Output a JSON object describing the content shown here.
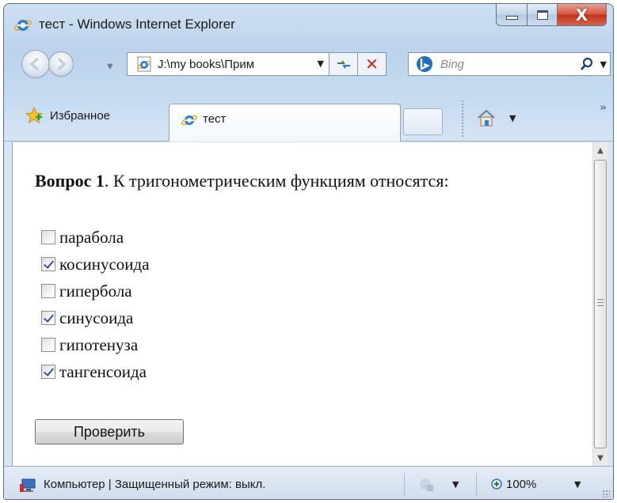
{
  "window": {
    "title": "тест - Windows Internet Explorer",
    "close_glyph": "X"
  },
  "nav": {
    "address": "J:\\my books\\Прим",
    "search_placeholder": "Bing"
  },
  "favorites": {
    "label": "Избранное"
  },
  "tab": {
    "label": "тест"
  },
  "content": {
    "question_bold": "Вопрос 1",
    "question_rest": ". К тригонометрическим функциям относятся:",
    "options": [
      {
        "label": "парабола",
        "checked": false
      },
      {
        "label": "косинусоида",
        "checked": true
      },
      {
        "label": "гипербола",
        "checked": false
      },
      {
        "label": "синусоида",
        "checked": true
      },
      {
        "label": "гипотенуза",
        "checked": false
      },
      {
        "label": "тангенсоида",
        "checked": true
      }
    ],
    "check_button": "Проверить"
  },
  "status": {
    "text": "Компьютер | Защищенный режим: выкл.",
    "zoom": "100%"
  },
  "icons": {
    "ie": "ie-logo-icon",
    "star": "star-icon",
    "home": "home-icon",
    "search": "magnifier-icon"
  },
  "colors": {
    "chrome": "#c6dbf1",
    "close": "#c3301a",
    "check": "#3b55a4"
  }
}
